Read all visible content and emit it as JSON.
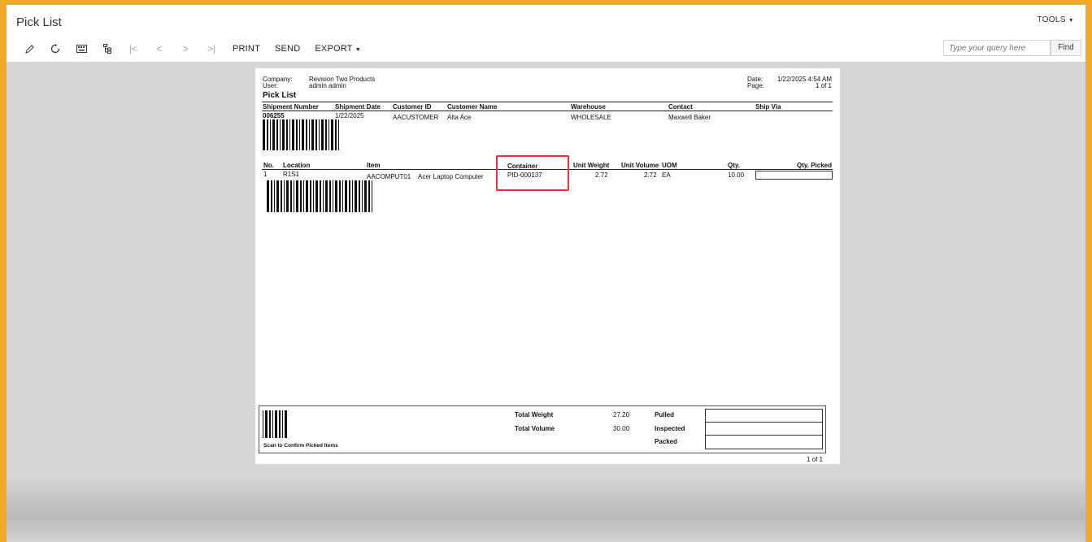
{
  "header": {
    "title": "Pick List",
    "tools_label": "TOOLS",
    "print_label": "PRINT",
    "send_label": "SEND",
    "export_label": "EXPORT",
    "search_placeholder": "Type your query here",
    "find_label": "Find"
  },
  "report": {
    "company_label": "Company:",
    "company": "Revision Two Products",
    "user_label": "User:",
    "user": "admin admin",
    "title": "Pick List",
    "date_label": "Date:",
    "date": "1/22/2025 4:54 AM",
    "page_label": "Page:",
    "page": "1 of 1",
    "shipment_headers": [
      "Shipment Number",
      "Shipment Date",
      "Customer ID",
      "Customer Name",
      "Warehouse",
      "Contact",
      "Ship Via"
    ],
    "shipment": {
      "number": "006255",
      "date": "1/22/2025",
      "customer_id": "AACUSTOMER",
      "customer_name": "Alta Ace",
      "warehouse": "WHOLESALE",
      "contact": "Maxwell Baker",
      "ship_via": ""
    },
    "line_headers": {
      "no": "No.",
      "location": "Location",
      "item": "Item",
      "container": "Container",
      "unit_weight": "Unit Weight",
      "unit_volume": "Unit Volume",
      "uom": "UOM",
      "qty": "Qty.",
      "qty_picked": "Qty. Picked"
    },
    "line": {
      "no": "1",
      "location": "R1S1",
      "item": "AACOMPUT01",
      "description": "Acer Laptop Computer",
      "container": "PID-000137",
      "unit_weight": "2.72",
      "unit_volume": "2.72",
      "uom": "EA",
      "qty": "10.00"
    },
    "footer": {
      "scan_label": "Scan to Confirm Picked Items",
      "total_weight_label": "Total Weight",
      "total_weight": "27.20",
      "total_volume_label": "Total Volume",
      "total_volume": "30.00",
      "pulled_label": "Pulled",
      "inspected_label": "Inspected",
      "packed_label": "Packed",
      "page_count": "1 of 1"
    }
  }
}
